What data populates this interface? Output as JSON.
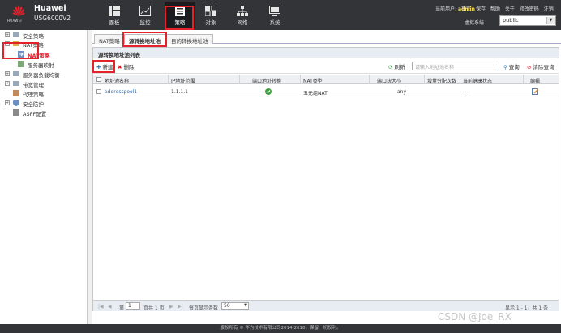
{
  "brand": {
    "name": "Huawei",
    "model": "USG6000V2",
    "logo_text": "HUAWEI"
  },
  "nav": [
    {
      "label": "面板",
      "icon": "dashboard-icon"
    },
    {
      "label": "监控",
      "icon": "monitor-icon"
    },
    {
      "label": "策略",
      "icon": "policy-icon"
    },
    {
      "label": "对象",
      "icon": "object-icon"
    },
    {
      "label": "网络",
      "icon": "network-icon"
    },
    {
      "label": "系统",
      "icon": "system-icon"
    }
  ],
  "header": {
    "user_label": "当前用户:",
    "user_name": "admin",
    "links": [
      "提交",
      "保存",
      "帮助",
      "关于",
      "修改密码",
      "注销"
    ],
    "vsys_label": "虚拟系统",
    "vsys_value": "public"
  },
  "sidebar": {
    "items": [
      {
        "label": "安全策略",
        "expander": "+"
      },
      {
        "label": "NAT策略",
        "expander": "-"
      },
      {
        "label": "NAT策略"
      },
      {
        "label": "服务器映射"
      },
      {
        "label": "服务器负载均衡",
        "expander": "+"
      },
      {
        "label": "带宽管理",
        "expander": "+"
      },
      {
        "label": "代理策略"
      },
      {
        "label": "安全防护",
        "expander": "+"
      },
      {
        "label": "ASPF配置"
      }
    ]
  },
  "tabs": [
    "NAT策略",
    "源转换地址池",
    "目的转换地址池"
  ],
  "panel": {
    "title": "源转换地址池列表",
    "new_label": "新建",
    "delete_label": "删除",
    "refresh_label": "刷新",
    "search_placeholder": "请输入地址池名称",
    "query_label": "查询",
    "clear_label": "清除查询"
  },
  "table": {
    "columns": [
      "地址池名称",
      "IP地址范围",
      "端口地址转换",
      "NAT类型",
      "端口块大小",
      "增量分配次数",
      "当前健康状态",
      "编辑"
    ],
    "rows": [
      {
        "name": "addresspool1",
        "ip_range": "1.1.1.1",
        "nat_type": "五元组NAT",
        "block_size": "any",
        "health": "---"
      }
    ]
  },
  "pager": {
    "page_label": "第",
    "page_value": "1",
    "total_label": "页共 1 页",
    "per_page_label": "每页显示条数",
    "per_page_value": "50",
    "summary": "显示 1 - 1，共 1 条"
  },
  "footer": "版权所有 © 华为技术有限公司2014-2018，保留一切权利。",
  "watermark": "CSDN @Joe_RX",
  "colors": {
    "header_bg": "#333438",
    "highlight": "#e5212c",
    "link": "#2a6cbf",
    "accent_user": "#ffe24a"
  }
}
